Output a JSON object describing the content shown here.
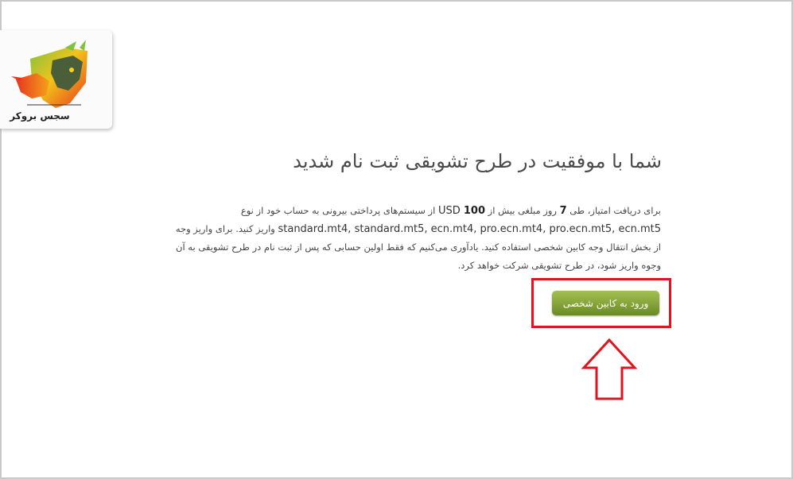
{
  "logo": {
    "text": "سجس بروکر",
    "icon": "wolf-head-logo-icon"
  },
  "main": {
    "title": "شما با موفقیت در طرح تشویقی ثبت نام شدید",
    "description": {
      "line1_prefix": "برای دریافت امتیاز، طی ",
      "days": "7",
      "line1_middle": " روز مبلغی بیش از ",
      "amount": "100",
      "currency": " USD",
      "line1_suffix": " از سیستم‌های پرداختی بیرونی به حساب خود از نوع",
      "account_types": "standard.mt4, standard.mt5, ecn.mt4, pro.ecn.mt4, pro.ecn.mt5, ecn.mt5",
      "line2_suffix": " واریز کنید. برای واریز وجه",
      "line3": "از بخش انتقال وجه کابین شخصی استفاده کنید. یادآوری می‌کنیم که فقط اولین حسابی که پس از ثبت نام در طرح تشویقی به آن",
      "line4": "وجوه واریز شود، در طرح تشویقی شرکت خواهد کرد."
    },
    "button_label": "ورود به کابین شخصی"
  },
  "annotation": {
    "highlight_color": "#e0141e",
    "arrow_icon": "up-arrow-icon"
  }
}
